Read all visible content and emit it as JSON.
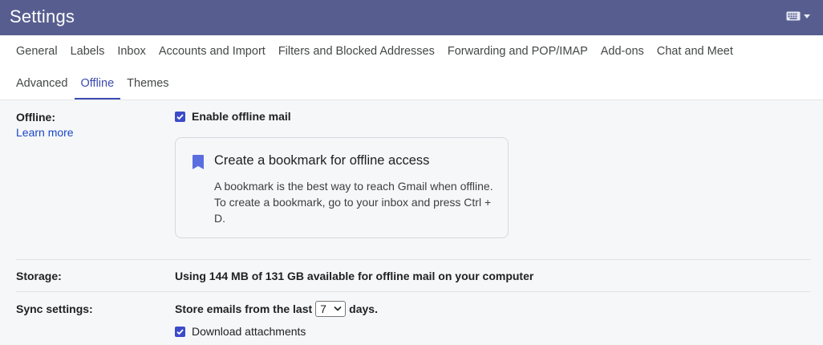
{
  "header": {
    "title": "Settings",
    "keyboard_icon": "keyboard-icon"
  },
  "tabs": {
    "row1": [
      "General",
      "Labels",
      "Inbox",
      "Accounts and Import",
      "Filters and Blocked Addresses",
      "Forwarding and POP/IMAP",
      "Add-ons",
      "Chat and Meet"
    ],
    "row2": [
      "Advanced",
      "Offline",
      "Themes"
    ],
    "active": "Offline"
  },
  "offline": {
    "label": "Offline:",
    "learn_more": "Learn more",
    "enable_label": "Enable offline mail",
    "enable_checked": true,
    "card": {
      "icon": "bookmark-icon",
      "title": "Create a bookmark for offline access",
      "text": "A bookmark is the best way to reach Gmail when offline. To create a bookmark, go to your inbox and press Ctrl + D."
    }
  },
  "storage": {
    "label": "Storage:",
    "value": "Using 144 MB of 131 GB available for offline mail on your computer"
  },
  "sync": {
    "label": "Sync settings:",
    "prefix": "Store emails from the last",
    "days_value": "7",
    "suffix": "days.",
    "attachments_label": "Download attachments",
    "attachments_checked": true
  },
  "colors": {
    "header": "#575e8f",
    "accent": "#3c4bb0",
    "link": "#1a47c7"
  }
}
